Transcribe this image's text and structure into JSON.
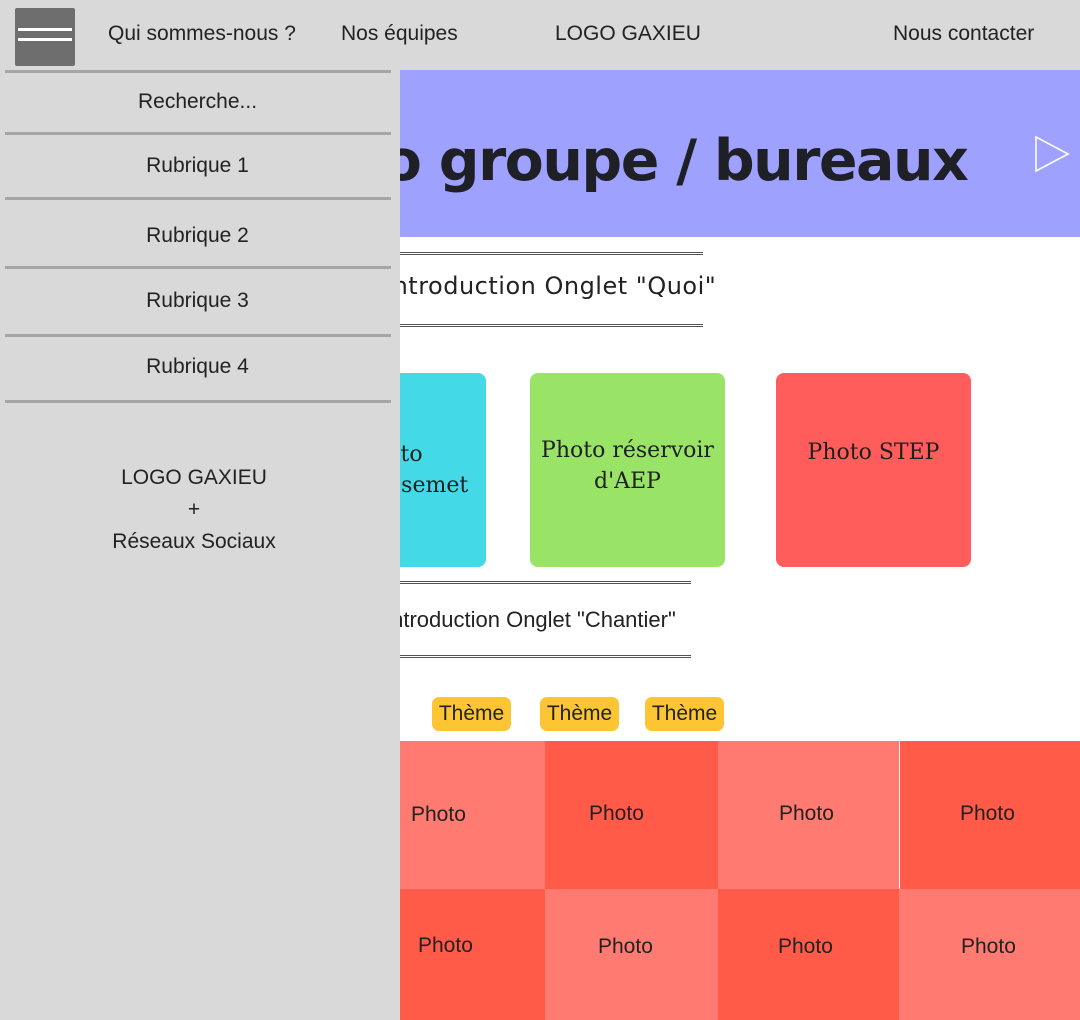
{
  "header": {
    "nav_items": [
      "Qui sommes-nous ?",
      "Nos équipes",
      "Nous contacter"
    ],
    "logo_text": "LOGO GAXIEU"
  },
  "hero": {
    "title": "Photo groupe / bureaux",
    "background_color": "#9ea2fe"
  },
  "section_quoi": {
    "intro": "Introduction Onglet \"Quoi\"",
    "tiles": [
      {
        "label": "Photo assainissemet",
        "color": "#44d9e6"
      },
      {
        "label": "Photo réservoir d'AEP",
        "color": "#99e366"
      },
      {
        "label": "Photo STEP",
        "color": "#ff5c5c"
      }
    ]
  },
  "section_chantier": {
    "intro": "Introduction Onglet \"Chantier\"",
    "themes": [
      "Thème",
      "Thème",
      "Thème"
    ],
    "theme_color": "#fdc534",
    "photos": [
      "Photo",
      "Photo",
      "Photo",
      "Photo",
      "Photo",
      "Photo",
      "Photo",
      "Photo"
    ],
    "photo_colors": [
      "#ff7b72",
      "#ff5b48"
    ]
  },
  "drawer": {
    "search_label": "Recherche...",
    "items": [
      "Rubrique 1",
      "Rubrique 2",
      "Rubrique 3",
      "Rubrique 4"
    ],
    "footer_lines": [
      "LOGO GAXIEU",
      "+",
      "Réseaux Sociaux"
    ]
  },
  "icons": {
    "menu": "hamburger-menu-icon",
    "next": "triangle-next-icon"
  }
}
